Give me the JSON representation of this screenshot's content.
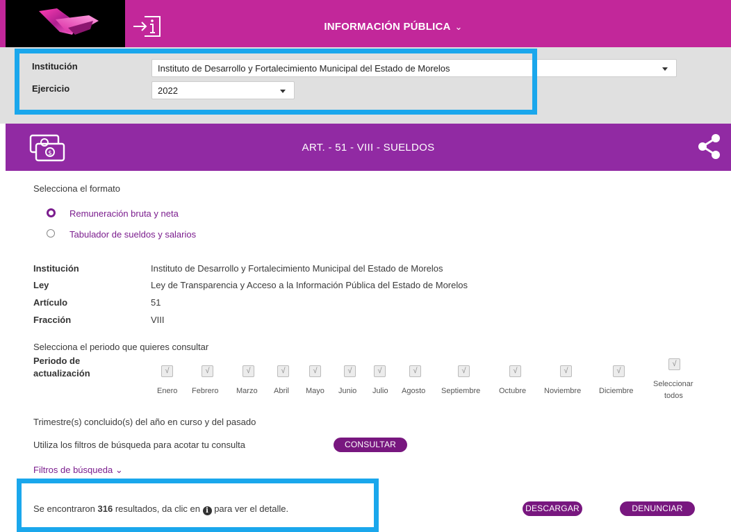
{
  "header": {
    "title": "INFORMACIÓN PÚBLICA",
    "title_chevron": "⌄",
    "logo_icon": "logo-icon",
    "info_icon": "info-document-icon"
  },
  "filters": {
    "institution_label": "Institución",
    "institution_value": "Instituto de Desarrollo y Fortalecimiento Municipal del Estado de Morelos",
    "year_label": "Ejercicio",
    "year_value": "2022"
  },
  "banner": {
    "title": "ART. - 51 - VIII - SUELDOS",
    "icon": "money-bills-icon",
    "share_icon": "share-icon"
  },
  "format": {
    "prompt": "Selecciona el formato",
    "options": [
      {
        "label": "Remuneración bruta y neta",
        "selected": true
      },
      {
        "label": "Tabulador de sueldos y salarios",
        "selected": false
      }
    ]
  },
  "info": [
    {
      "label": "Institución",
      "value": "Instituto de Desarrollo y Fortalecimiento Municipal del Estado de Morelos"
    },
    {
      "label": "Ley",
      "value": "Ley de Transparencia y Acceso a la Información Pública del Estado de Morelos"
    },
    {
      "label": "Artículo",
      "value": "51"
    },
    {
      "label": "Fracción",
      "value": "VIII"
    }
  ],
  "period": {
    "prompt": "Selecciona el periodo que quieres consultar",
    "label_line1": "Periodo de",
    "label_line2": "actualización",
    "months": [
      "Enero",
      "Febrero",
      "Marzo",
      "Abril",
      "Mayo",
      "Junio",
      "Julio",
      "Agosto",
      "Septiembre",
      "Octubre",
      "Noviembre",
      "Diciembre"
    ],
    "select_all_line1": "Seleccionar",
    "select_all_line2": "todos",
    "check_glyph": "√"
  },
  "notes": {
    "quarters": "Trimestre(s) concluido(s) del año en curso y del pasado",
    "filters_hint": "Utiliza los filtros de búsqueda para acotar tu consulta",
    "consult_button": "CONSULTAR",
    "search_filters": "Filtros de búsqueda",
    "search_filters_chevron": "⌄"
  },
  "results": {
    "prefix": "Se encontraron ",
    "count": "316",
    "middle": " resultados, da clic en ",
    "suffix": " para ver el detalle.",
    "info_glyph": "i",
    "download_button": "DESCARGAR",
    "report_button": "DENUNCIAR"
  },
  "colors": {
    "header_bg": "#c2279a",
    "banner_bg": "#912aa3",
    "accent_purple": "#7b1d8e",
    "button_bg": "#78177f",
    "highlight_blue": "#1aa7ec",
    "filter_bar_bg": "#e0e0e0"
  }
}
